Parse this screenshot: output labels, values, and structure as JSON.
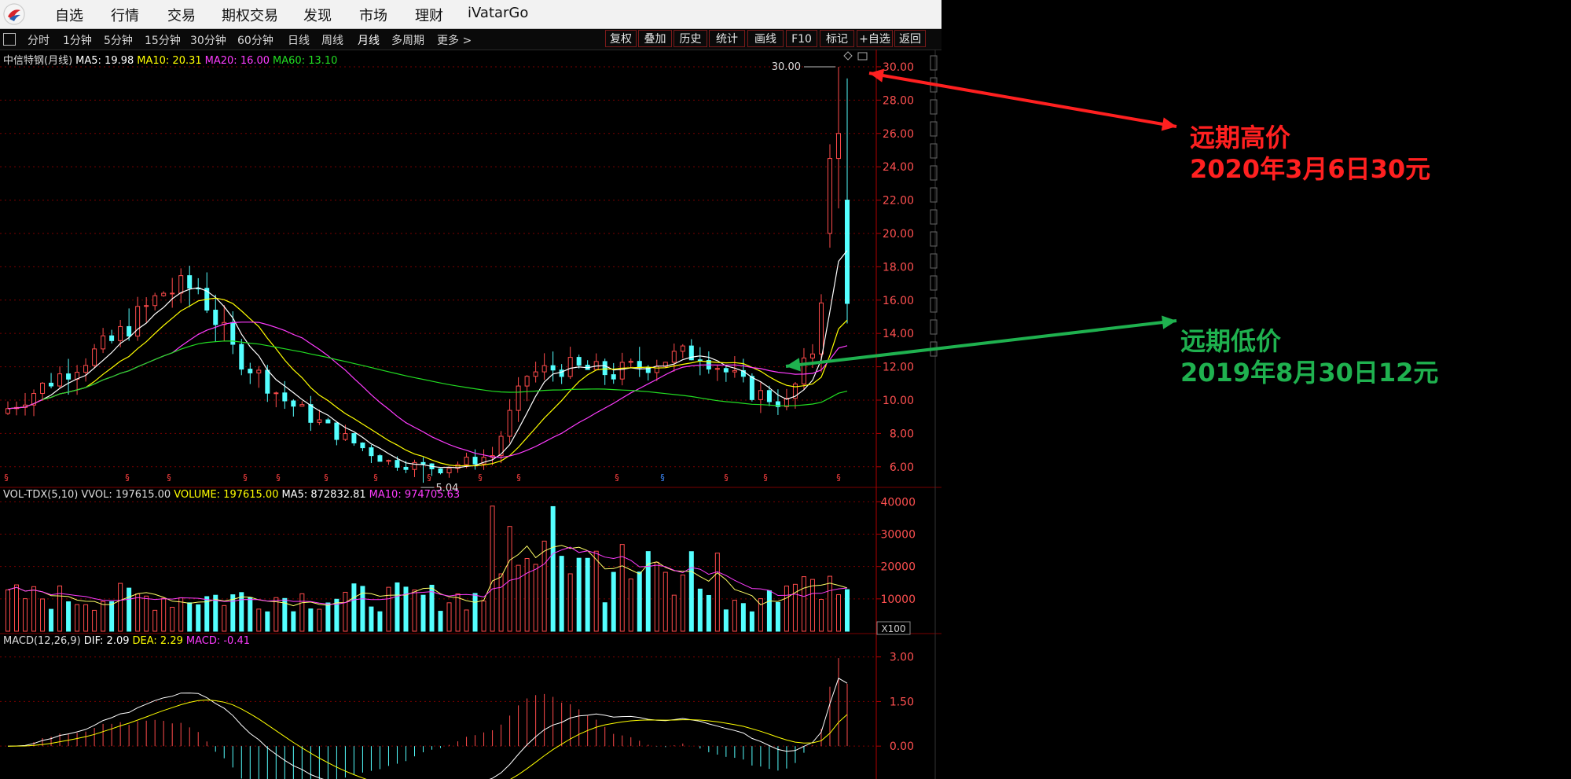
{
  "app": {
    "nav": [
      "自选",
      "行情",
      "交易",
      "期权交易",
      "发现",
      "市场",
      "理财",
      "iVatarGo"
    ]
  },
  "periods": [
    "分时",
    "1分钟",
    "5分钟",
    "15分钟",
    "30分钟",
    "60分钟",
    "日线",
    "周线",
    "月线",
    "多周期",
    "更多 >"
  ],
  "selected_period": "月线",
  "right_tools": [
    "复权",
    "叠加",
    "历史",
    "统计",
    "画线",
    "F10",
    "标记",
    "+自选",
    "返回"
  ],
  "price_panel": {
    "title": "中信特钢(月线)",
    "ma5": "MA5: 19.98",
    "ma10": "MA10: 20.31",
    "ma20": "MA20: 16.00",
    "ma60": "MA60: 13.10",
    "y_ticks": [
      "30.00",
      "28.00",
      "26.00",
      "24.00",
      "22.00",
      "20.00",
      "18.00",
      "16.00",
      "14.00",
      "12.00",
      "10.00",
      "8.00",
      "6.00"
    ],
    "high_label": "30.00",
    "low_label": "5.04"
  },
  "vol_panel": {
    "title": "VOL-TDX(5,10)",
    "vvol": "VVOL: 197615.00",
    "volume": "VOLUME: 197615.00",
    "ma5": "MA5: 872832.81",
    "ma10": "MA10: 974705.63",
    "y_ticks": [
      "40000",
      "30000",
      "20000",
      "10000"
    ],
    "unit": "X100"
  },
  "macd_panel": {
    "title": "MACD(12,26,9)",
    "dif": "DIF: 2.09",
    "dea": "DEA: 2.29",
    "macd": "MACD: -0.41",
    "y_ticks": [
      "3.00",
      "1.50",
      "0.00"
    ]
  },
  "annotations": {
    "high": [
      "远期高价",
      "2020年3月6日30元"
    ],
    "low": [
      "远期低价",
      "2019年8月30日12元"
    ]
  },
  "colors": {
    "up": "#ff4b4b",
    "down": "#54ffff",
    "ma5": "#ffffff",
    "ma10": "#ffff00",
    "ma20": "#ff3cff",
    "ma60": "#22dd22",
    "grid": "#7a0000",
    "axis_text": "#ff5050",
    "anno_high": "#ff2020",
    "anno_low": "#1fb14f"
  }
}
